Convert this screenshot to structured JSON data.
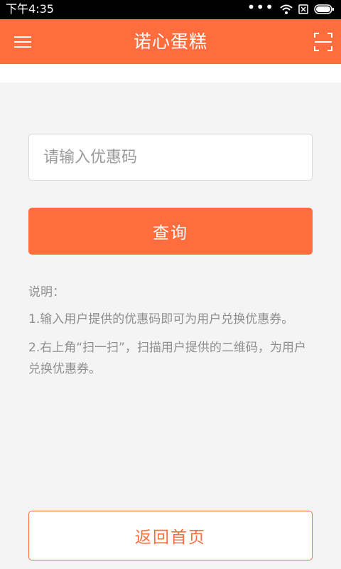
{
  "status_bar": {
    "time": "下午4:35",
    "icons": [
      "more-dots-icon",
      "wifi-icon",
      "sim-x-icon",
      "battery-icon"
    ]
  },
  "app_bar": {
    "title": "诺心蛋糕",
    "left_icon": "menu-icon",
    "right_icon": "scan-icon",
    "color": "#ff6d3f"
  },
  "coupon_form": {
    "input_placeholder": "请输入优惠码",
    "input_value": "",
    "query_button": "查询"
  },
  "instructions": {
    "heading": "说明：",
    "items": [
      "1.输入用户提供的优惠码即可为用户兑换优惠券。",
      "2.右上角“扫一扫”，扫描用户提供的二维码，为用户兑换优惠券。"
    ]
  },
  "footer": {
    "home_button": "返回首页"
  }
}
